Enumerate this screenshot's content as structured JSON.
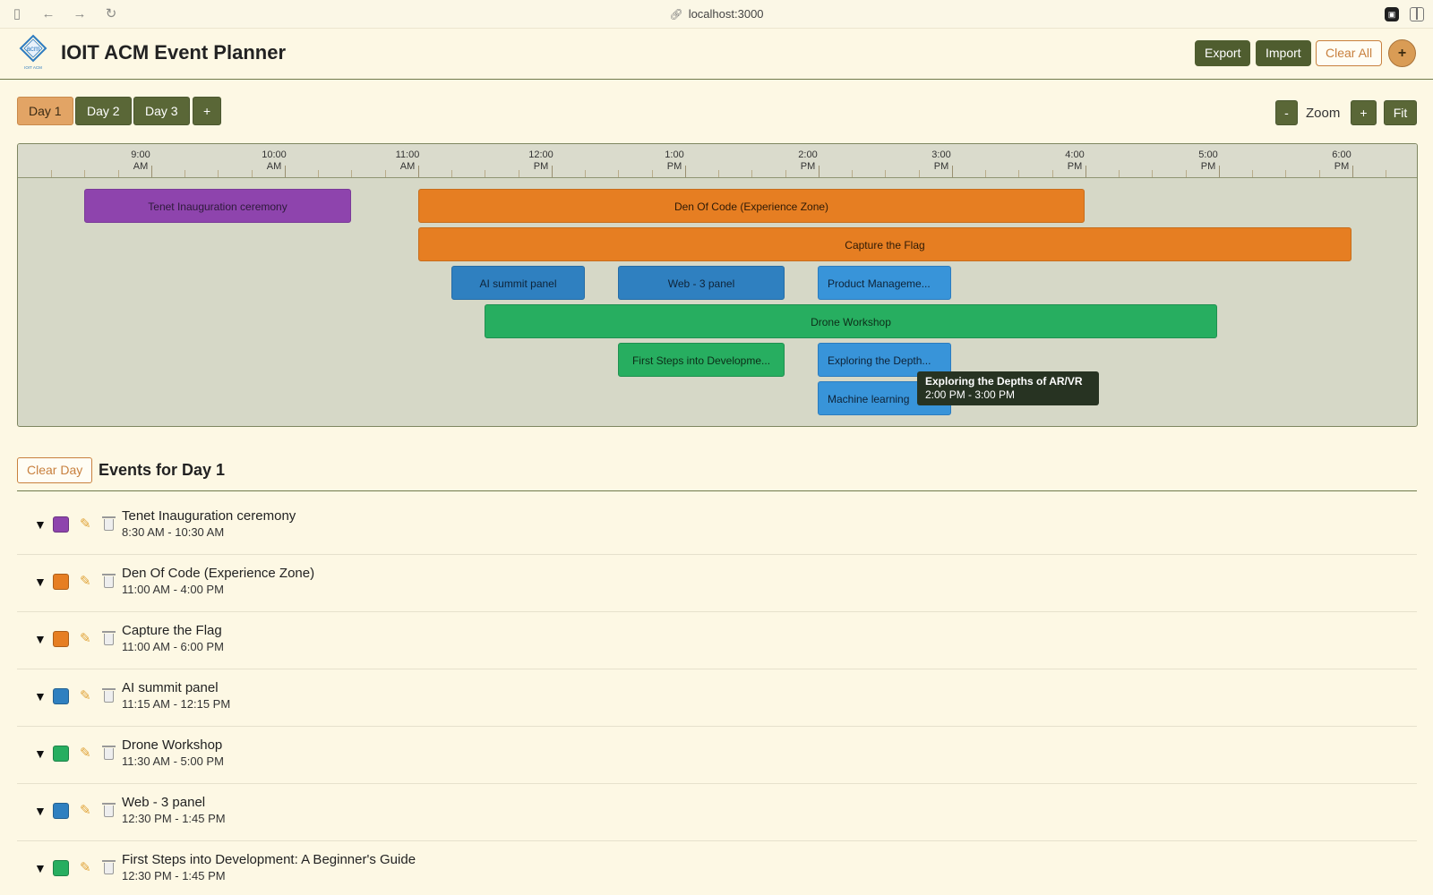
{
  "browser": {
    "url": "localhost:3000"
  },
  "header": {
    "title": "IOIT ACM Event Planner",
    "logo_text": "acm",
    "logo_subtext": "IOIT ACM",
    "export_label": "Export",
    "import_label": "Import",
    "clear_all_label": "Clear All",
    "add_label": "+"
  },
  "days": {
    "tabs": [
      {
        "label": "Day 1",
        "active": true
      },
      {
        "label": "Day 2",
        "active": false
      },
      {
        "label": "Day 3",
        "active": false
      }
    ],
    "add_label": "+"
  },
  "zoom": {
    "minus_label": "-",
    "label": "Zoom",
    "plus_label": "+",
    "fit_label": "Fit"
  },
  "timeline": {
    "ticks": [
      {
        "time": "9:00",
        "period": "AM"
      },
      {
        "time": "10:00",
        "period": "AM"
      },
      {
        "time": "11:00",
        "period": "AM"
      },
      {
        "time": "12:00",
        "period": "PM"
      },
      {
        "time": "1:00",
        "period": "PM"
      },
      {
        "time": "2:00",
        "period": "PM"
      },
      {
        "time": "3:00",
        "period": "PM"
      },
      {
        "time": "4:00",
        "period": "PM"
      },
      {
        "time": "5:00",
        "period": "PM"
      },
      {
        "time": "6:00",
        "period": "PM"
      }
    ],
    "bars": [
      {
        "label": "Tenet Inauguration ceremony"
      },
      {
        "label": "Den Of Code (Experience Zone)"
      },
      {
        "label": "Capture the Flag"
      },
      {
        "label": "AI summit panel"
      },
      {
        "label": "Web - 3 panel"
      },
      {
        "label": "Product Manageme..."
      },
      {
        "label": "Drone Workshop"
      },
      {
        "label": "First Steps into Developme..."
      },
      {
        "label": "Exploring the Depth..."
      },
      {
        "label": "Machine learning"
      }
    ],
    "tooltip": {
      "title": "Exploring the Depths of AR/VR",
      "time": "2:00 PM - 3:00 PM"
    }
  },
  "events_list": {
    "clear_day_label": "Clear Day",
    "title": "Events for Day 1",
    "items": [
      {
        "name": "Tenet Inauguration ceremony",
        "time": "8:30 AM - 10:30 AM",
        "color": "#8e44ad"
      },
      {
        "name": "Den Of Code (Experience Zone)",
        "time": "11:00 AM - 4:00 PM",
        "color": "#e67e22"
      },
      {
        "name": "Capture the Flag",
        "time": "11:00 AM - 6:00 PM",
        "color": "#e67e22"
      },
      {
        "name": "AI summit panel",
        "time": "11:15 AM - 12:15 PM",
        "color": "#2f80c0"
      },
      {
        "name": "Drone Workshop",
        "time": "11:30 AM - 5:00 PM",
        "color": "#27ae60"
      },
      {
        "name": "Web - 3 panel",
        "time": "12:30 PM - 1:45 PM",
        "color": "#2f80c0"
      },
      {
        "name": "First Steps into Development: A Beginner's Guide",
        "time": "12:30 PM - 1:45 PM",
        "color": "#27ae60"
      }
    ]
  },
  "colors": {
    "accent": "#4f5d2f",
    "active_tab": "#e2a465",
    "background": "#fdf8e4"
  }
}
